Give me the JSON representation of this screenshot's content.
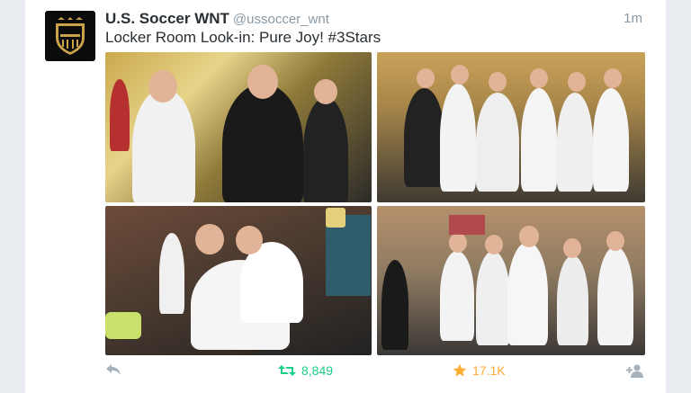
{
  "tweet": {
    "account_name": "U.S. Soccer WNT",
    "handle": "@ussoccer_wnt",
    "time": "1m",
    "text": "Locker Room Look-in: Pure Joy! #3Stars"
  },
  "actions": {
    "retweet_count": "8,849",
    "favorite_count": "17.1K"
  },
  "colors": {
    "retweet": "#19cf86",
    "favorite": "#ffac33",
    "muted": "#8899a6"
  },
  "icons": [
    "reply-icon",
    "retweet-icon",
    "star-icon",
    "follow-icon"
  ]
}
